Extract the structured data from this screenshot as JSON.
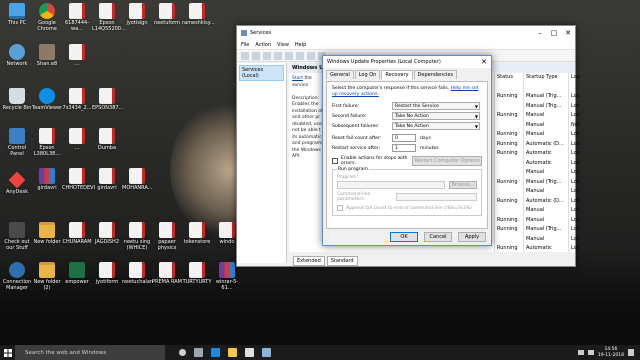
{
  "desktop": {
    "icons": [
      {
        "label": "This PC",
        "type": "pc"
      },
      {
        "label": "Google Chrome",
        "type": "chrome"
      },
      {
        "label": "6187444-wa...",
        "type": "pdf"
      },
      {
        "label": "Epson L14Q55200...",
        "type": "pdf"
      },
      {
        "label": "jyotisign",
        "type": "pdf"
      },
      {
        "label": "neetuform",
        "type": "pdf"
      },
      {
        "label": "rameshkisy...",
        "type": "pdf"
      },
      {
        "label": "Network",
        "type": "net"
      },
      {
        "label": "Shan.e8",
        "type": "img"
      },
      {
        "label": "...",
        "type": "pdf"
      },
      {
        "label": "Recycle Bin",
        "type": "bin"
      },
      {
        "label": "TeamViewer",
        "type": "tv"
      },
      {
        "label": "7s3434_2...",
        "type": "pdf"
      },
      {
        "label": "EPSON387...",
        "type": "pdf"
      },
      {
        "label": "Control Panel",
        "type": "cp"
      },
      {
        "label": "Epson L380L38...",
        "type": "pdf"
      },
      {
        "label": "...",
        "type": "pdf"
      },
      {
        "label": "Dumba",
        "type": "pdf"
      },
      {
        "label": "girdavri",
        "type": "winrar"
      },
      {
        "label": "CHHOTEDEVI",
        "type": "pdf"
      },
      {
        "label": "girdavri",
        "type": "pdf"
      },
      {
        "label": "MOHANRA...",
        "type": "pdf"
      },
      {
        "label": "AnyDesk",
        "type": "anydesk"
      },
      {
        "label": "Check out our Stuff",
        "type": "app"
      },
      {
        "label": "New folder",
        "type": "folder"
      },
      {
        "label": "CHUNARAM",
        "type": "pdf"
      },
      {
        "label": "JAGDISH2",
        "type": "pdf"
      },
      {
        "label": "neetu sing (WHICE)",
        "type": "pdf"
      },
      {
        "label": "papaer physics",
        "type": "pdf"
      },
      {
        "label": "tokenstore",
        "type": "pdf"
      },
      {
        "label": "windo",
        "type": "pdf"
      },
      {
        "label": "Connection Manager",
        "type": "conn"
      },
      {
        "label": "New folder (2)",
        "type": "folder"
      },
      {
        "label": "empower",
        "type": "excel"
      },
      {
        "label": "jyotiform",
        "type": "pdf"
      },
      {
        "label": "neetuchalan",
        "type": "pdf"
      },
      {
        "label": "PREMA RAM",
        "type": "pdf"
      },
      {
        "label": "TURTYURTY",
        "type": "pdf"
      },
      {
        "label": "winrar-5-61...",
        "type": "winrar"
      }
    ]
  },
  "services_window": {
    "title": "Services",
    "menu": [
      "File",
      "Action",
      "View",
      "Help"
    ],
    "tree_item": "Services (Local)",
    "header": "Windows Upda",
    "desc_link": "Start",
    "desc_link_rest": "the service",
    "desc_label": "Description:",
    "desc_text": "Enables the installation of and other pr disabled, use not be able t its automatic and programs the Windows API.",
    "columns": [
      {
        "header": "Status",
        "rows": [
          "",
          "Running",
          "",
          "Running",
          "",
          "Running",
          "Running",
          "Running",
          "",
          "",
          "Running",
          "",
          "Running",
          "",
          "Running",
          "Running",
          "",
          "Running"
        ]
      },
      {
        "header": "Startup Type",
        "rows": [
          "",
          "Manual (Trig...",
          "Manual (Trig...",
          "Manual",
          "Manual",
          "Manual",
          "Automatic (D...",
          "Automatic",
          "Automatic",
          "Manual",
          "Manual (Trig...",
          "Manual",
          "Automatic (D...",
          "Manual",
          "Manual",
          "Manual (Trig...",
          "Manual",
          "Automatic"
        ]
      },
      {
        "header": "Log",
        "rows": [
          "",
          "Loc",
          "Loc",
          "Loc",
          "Net",
          "Loc",
          "Loc",
          "Loc",
          "Loc",
          "Loc",
          "Loc",
          "Loc",
          "Loc",
          "Loc",
          "Loc",
          "Loc",
          "Loc",
          "Loc"
        ]
      }
    ],
    "tabs_bottom": [
      "Extended",
      "Standard"
    ]
  },
  "dialog": {
    "title": "Windows Update Properties (Local Computer)",
    "tabs": [
      "General",
      "Log On",
      "Recovery",
      "Dependencies"
    ],
    "intro_text": "Select the computer's response if this service fails.",
    "intro_link": "Help me set up recovery actions.",
    "first_failure_label": "First failure:",
    "first_failure_value": "Restart the Service",
    "second_failure_label": "Second failure:",
    "second_failure_value": "Take No Action",
    "subsequent_label": "Subsequent failures:",
    "subsequent_value": "Take No Action",
    "reset_label": "Reset fail count after:",
    "reset_value": "0",
    "reset_unit": "days",
    "restart_label": "Restart service after:",
    "restart_value": "1",
    "restart_unit": "minutes",
    "enable_actions_label": "Enable actions for stops with errors.",
    "restart_computer_button": "Restart Computer Options",
    "run_program_legend": "Run program",
    "program_label": "Program:",
    "browse_button": "Browse...",
    "cmd_params_label": "Command line parameters:",
    "append_label": "Append fail count to end of command line (/fail=%1%)",
    "ok_button": "OK",
    "cancel_button": "Cancel",
    "apply_button": "Apply"
  },
  "taskbar": {
    "search_placeholder": "Search the web and Windows",
    "time": "14:56",
    "date": "19-11-2018"
  }
}
